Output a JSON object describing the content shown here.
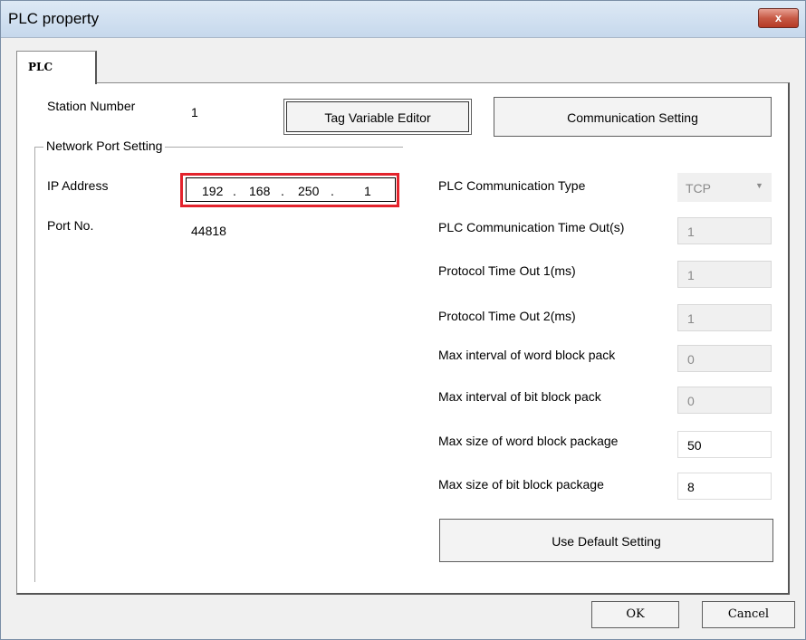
{
  "window": {
    "title": "PLC property",
    "close_label": "x"
  },
  "tabs": [
    {
      "label": "PLC"
    }
  ],
  "station": {
    "label": "Station Number",
    "value": "1"
  },
  "buttons": {
    "tag_editor": "Tag Variable Editor",
    "comm_setting": "Communication Setting",
    "default_setting": "Use Default Setting",
    "ok": "OK",
    "cancel": "Cancel"
  },
  "network": {
    "group_label": "Network Port Setting",
    "ip_label": "IP Address",
    "ip": [
      "192",
      "168",
      "250",
      "1"
    ],
    "ip_dot": ".",
    "port_label": "Port No.",
    "port_value": "44818"
  },
  "plc": {
    "comm_type_label": "PLC Communication Type",
    "comm_type_value": "TCP",
    "timeout_label": "PLC Communication Time Out(s)",
    "timeout_value": "1",
    "proto1_label": "Protocol Time Out 1(ms)",
    "proto1_value": "1",
    "proto2_label": "Protocol Time Out 2(ms)",
    "proto2_value": "1",
    "word_interval_label": "Max interval of word block pack",
    "word_interval_value": "0",
    "bit_interval_label": "Max interval of bit block pack",
    "bit_interval_value": "0",
    "word_size_label": "Max size of word block package",
    "word_size_value": "50",
    "bit_size_label": "Max size of bit block package",
    "bit_size_value": "8"
  },
  "colors": {
    "highlight": "#e3232c",
    "close": "#c75a46"
  }
}
